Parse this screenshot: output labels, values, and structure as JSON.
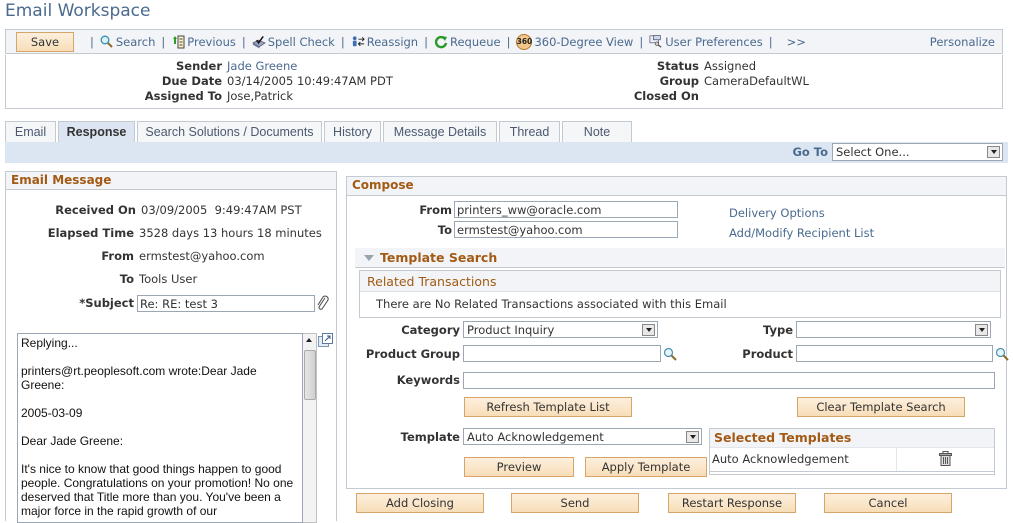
{
  "page": {
    "title": "Email Workspace"
  },
  "toolbar": {
    "save_label": "Save",
    "links": [
      {
        "label": "Search",
        "icon": "search-icon"
      },
      {
        "label": "Previous",
        "icon": "previous-icon"
      },
      {
        "label": "Spell Check",
        "icon": "spell-check-icon"
      },
      {
        "label": "Reassign",
        "icon": "reassign-icon"
      },
      {
        "label": "Requeue",
        "icon": "requeue-icon"
      },
      {
        "label": "360-Degree View",
        "icon": "360-view-icon",
        "badge": "360"
      },
      {
        "label": "User Preferences",
        "icon": "user-preferences-icon"
      }
    ],
    "more_label": ">>",
    "separator": "|",
    "personalize_label": "Personalize"
  },
  "header": {
    "sender_label": "Sender",
    "sender": "Jade Greene",
    "due_date_label": "Due Date",
    "due_date": "03/14/2005 10:49:47AM PDT",
    "assigned_to_label": "Assigned To",
    "assigned_to": "Jose,Patrick",
    "status_label": "Status",
    "status": "Assigned",
    "group_label": "Group",
    "group": "CameraDefaultWL",
    "closed_on_label": "Closed On",
    "closed_on": ""
  },
  "tabs": [
    {
      "label": "Email",
      "active": false
    },
    {
      "label": "Response",
      "active": true
    },
    {
      "label": "Search Solutions / Documents",
      "active": false
    },
    {
      "label": "History",
      "active": false
    },
    {
      "label": "Message Details",
      "active": false
    },
    {
      "label": "Thread",
      "active": false
    },
    {
      "label": "Note",
      "active": false
    }
  ],
  "goto": {
    "label": "Go To",
    "value": "Select One..."
  },
  "email_message": {
    "title": "Email Message",
    "received_on_label": "Received On",
    "received_on": "03/09/2005  9:49:47AM PST",
    "elapsed_label": "Elapsed Time",
    "elapsed": "3528 days 13 hours 18 minutes",
    "from_label": "From",
    "from": "ermstest@yahoo.com",
    "to_label": "To",
    "to": "Tools User",
    "subject_label": "*Subject",
    "subject": "Re: RE: test 3",
    "body": "Replying...\n\nprinters@rt.peoplesoft.com wrote:Dear Jade Greene:\n\n2005-03-09\n\nDear Jade Greene:\n\nIt's nice to know that good things happen to good people. Congratulations on your promotion! No one deserved that Title more than you. You've been a major force in the rapid growth of our"
  },
  "compose": {
    "title": "Compose",
    "from_label": "From",
    "from": "printers_ww@oracle.com",
    "to_label": "To",
    "to": "ermstest@yahoo.com",
    "delivery_options": "Delivery Options",
    "recipient_list": "Add/Modify Recipient List",
    "template_search": {
      "title": "Template Search",
      "related_title": "Related Transactions",
      "related_message": "There are No Related Transactions associated with this Email",
      "category_label": "Category",
      "category": "Product Inquiry",
      "type_label": "Type",
      "type": "",
      "product_group_label": "Product Group",
      "product_group": "",
      "product_label": "Product",
      "product": "",
      "keywords_label": "Keywords",
      "keywords": "",
      "refresh_label": "Refresh Template List",
      "clear_label": "Clear Template Search"
    },
    "template_label": "Template",
    "template": "Auto Acknowledgement",
    "preview_label": "Preview",
    "apply_label": "Apply Template",
    "selected_templates": {
      "title": "Selected Templates",
      "rows": [
        {
          "name": "Auto Acknowledgement"
        }
      ]
    }
  },
  "actions": {
    "add_closing": "Add Closing",
    "send": "Send",
    "restart": "Restart Response",
    "cancel": "Cancel"
  }
}
